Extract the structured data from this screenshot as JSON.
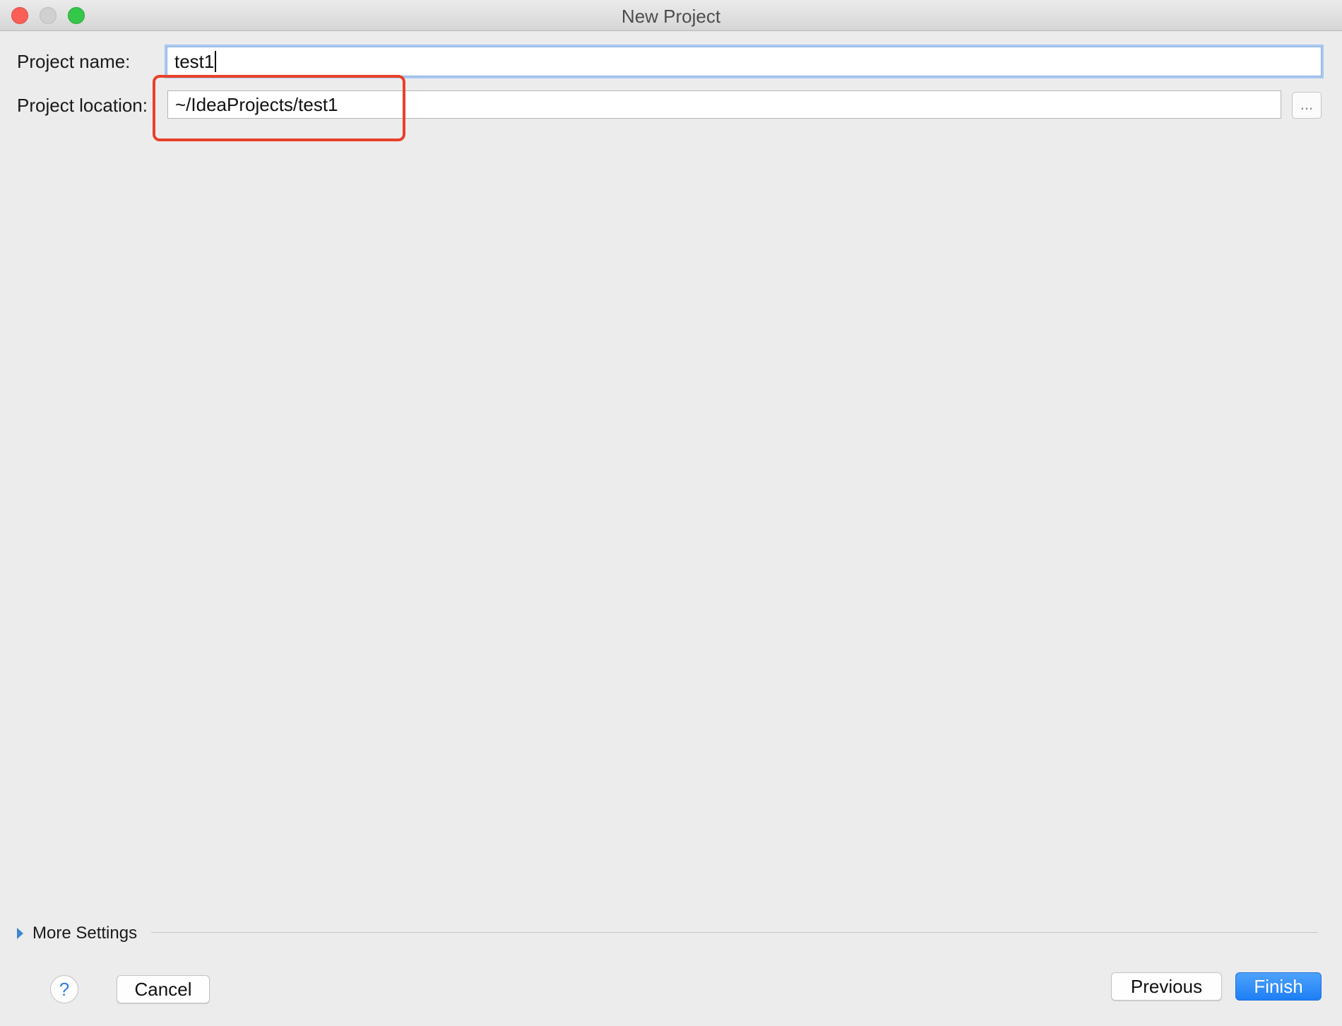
{
  "window": {
    "title": "New Project"
  },
  "form": {
    "project_name_label": "Project name:",
    "project_name_value": "test1",
    "project_location_label": "Project location:",
    "project_location_value": "~/IdeaProjects/test1",
    "browse_label": "..."
  },
  "more_settings": {
    "label": "More Settings"
  },
  "buttons": {
    "help": "?",
    "cancel": "Cancel",
    "previous": "Previous",
    "finish": "Finish"
  },
  "colors": {
    "accent": "#1d7ef5",
    "highlight": "#e8412a",
    "background": "#ececec"
  },
  "icons": {
    "close": "close-icon",
    "minimize": "minimize-icon",
    "zoom": "zoom-icon",
    "disclosure": "disclosure-triangle-icon",
    "help": "help-icon"
  }
}
